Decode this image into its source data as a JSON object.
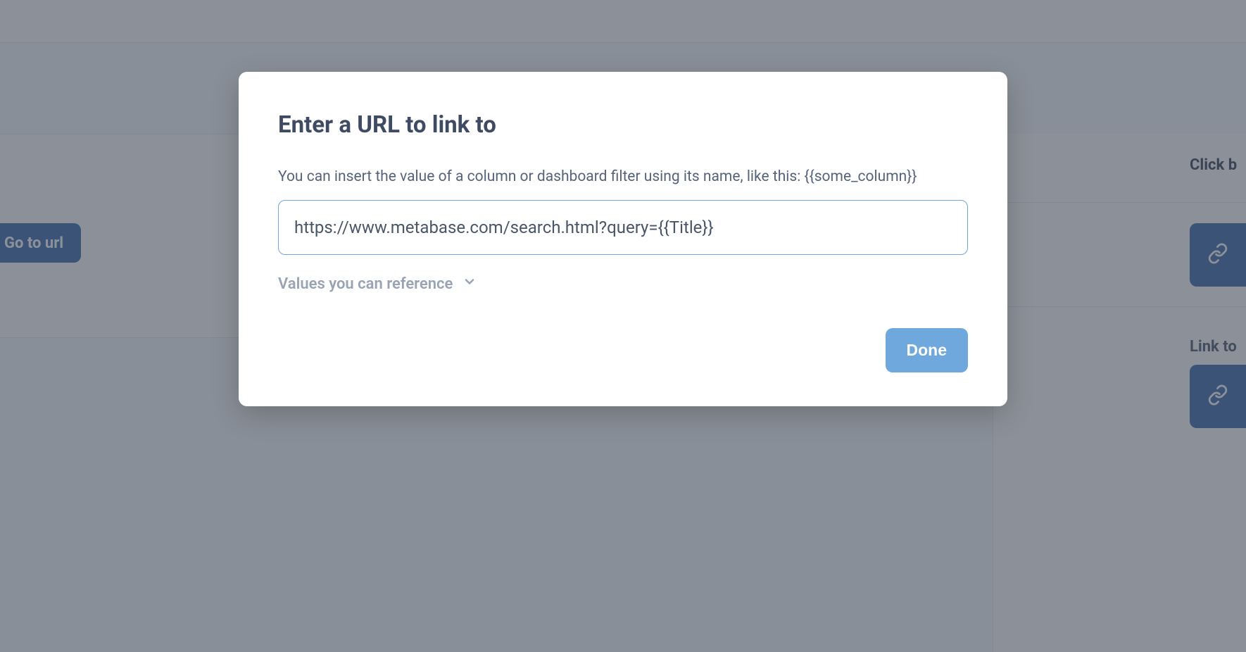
{
  "background": {
    "go_to_url_label": "Go to url",
    "right_label_1": "Click b",
    "right_label_2": "Link to"
  },
  "modal": {
    "title": "Enter a URL to link to",
    "help_text": "You can insert the value of a column or dashboard filter using its name, like this: {{some_column}}",
    "url_value": "https://www.metabase.com/search.html?query={{Title}}",
    "values_toggle_label": "Values you can reference",
    "done_label": "Done"
  }
}
